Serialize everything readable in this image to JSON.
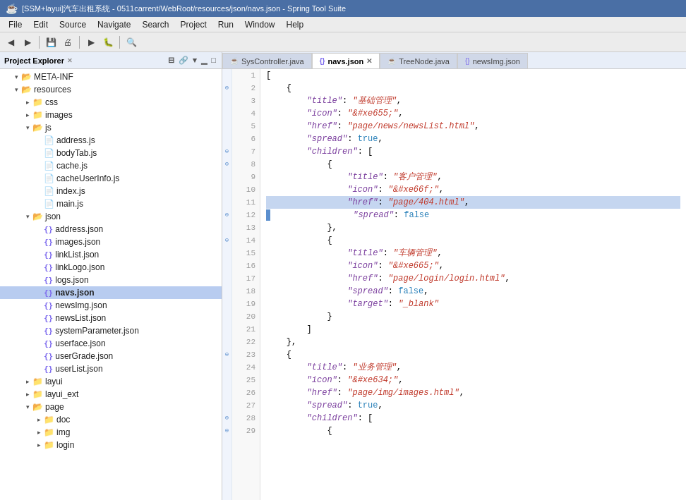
{
  "titleBar": {
    "icon": "☕",
    "title": "[SSM+layui]汽车出租系统 - 0511carrent/WebRoot/resources/json/navs.json - Spring Tool Suite"
  },
  "menuBar": {
    "items": [
      "File",
      "Edit",
      "Source",
      "Navigate",
      "Search",
      "Project",
      "Run",
      "Window",
      "Help"
    ]
  },
  "projectExplorer": {
    "title": "Project Explorer",
    "tree": [
      {
        "indent": 0,
        "expanded": true,
        "icon": "folder",
        "label": "META-INF",
        "type": "folder"
      },
      {
        "indent": 0,
        "expanded": true,
        "icon": "folder",
        "label": "resources",
        "type": "folder"
      },
      {
        "indent": 1,
        "expanded": false,
        "icon": "folder",
        "label": "css",
        "type": "folder"
      },
      {
        "indent": 1,
        "expanded": false,
        "icon": "folder",
        "label": "images",
        "type": "folder"
      },
      {
        "indent": 1,
        "expanded": true,
        "icon": "folder",
        "label": "js",
        "type": "folder"
      },
      {
        "indent": 2,
        "icon": "file-js",
        "label": "address.js",
        "type": "file"
      },
      {
        "indent": 2,
        "icon": "file-js",
        "label": "bodyTab.js",
        "type": "file"
      },
      {
        "indent": 2,
        "icon": "file-js",
        "label": "cache.js",
        "type": "file"
      },
      {
        "indent": 2,
        "icon": "file-js",
        "label": "cacheUserInfo.js",
        "type": "file"
      },
      {
        "indent": 2,
        "icon": "file-js",
        "label": "index.js",
        "type": "file"
      },
      {
        "indent": 2,
        "icon": "file-js",
        "label": "main.js",
        "type": "file"
      },
      {
        "indent": 1,
        "expanded": true,
        "icon": "folder",
        "label": "json",
        "type": "folder"
      },
      {
        "indent": 2,
        "icon": "file-json",
        "label": "address.json",
        "type": "file"
      },
      {
        "indent": 2,
        "icon": "file-json",
        "label": "images.json",
        "type": "file"
      },
      {
        "indent": 2,
        "icon": "file-json",
        "label": "linkList.json",
        "type": "file"
      },
      {
        "indent": 2,
        "icon": "file-json",
        "label": "linkLogo.json",
        "type": "file"
      },
      {
        "indent": 2,
        "icon": "file-json",
        "label": "logs.json",
        "type": "file"
      },
      {
        "indent": 2,
        "icon": "file-json",
        "label": "navs.json",
        "type": "file",
        "selected": true
      },
      {
        "indent": 2,
        "icon": "file-json",
        "label": "newsImg.json",
        "type": "file"
      },
      {
        "indent": 2,
        "icon": "file-json",
        "label": "newsList.json",
        "type": "file"
      },
      {
        "indent": 2,
        "icon": "file-json",
        "label": "systemParameter.json",
        "type": "file"
      },
      {
        "indent": 2,
        "icon": "file-json",
        "label": "userface.json",
        "type": "file"
      },
      {
        "indent": 2,
        "icon": "file-json",
        "label": "userGrade.json",
        "type": "file"
      },
      {
        "indent": 2,
        "icon": "file-json",
        "label": "userList.json",
        "type": "file"
      },
      {
        "indent": 1,
        "expanded": false,
        "icon": "folder",
        "label": "layui",
        "type": "folder"
      },
      {
        "indent": 1,
        "expanded": false,
        "icon": "folder",
        "label": "layui_ext",
        "type": "folder"
      },
      {
        "indent": 1,
        "expanded": true,
        "icon": "folder",
        "label": "page",
        "type": "folder"
      },
      {
        "indent": 2,
        "expanded": false,
        "icon": "folder",
        "label": "doc",
        "type": "folder"
      },
      {
        "indent": 2,
        "expanded": false,
        "icon": "folder",
        "label": "img",
        "type": "folder"
      },
      {
        "indent": 2,
        "expanded": false,
        "icon": "folder",
        "label": "login",
        "type": "folder"
      }
    ]
  },
  "editorTabs": [
    {
      "id": "syscontroller",
      "label": "SysController.java",
      "icon": "java",
      "active": false,
      "closeable": false
    },
    {
      "id": "navsjson",
      "label": "navs.json",
      "icon": "json",
      "active": true,
      "closeable": true
    },
    {
      "id": "treenode",
      "label": "TreeNode.java",
      "icon": "java",
      "active": false,
      "closeable": false
    },
    {
      "id": "newsimgjson",
      "label": "newsImg.json",
      "icon": "json",
      "active": false,
      "closeable": false
    }
  ],
  "codeLines": [
    {
      "num": 1,
      "gutter": "",
      "content": "[",
      "highlight": false
    },
    {
      "num": 2,
      "gutter": "collapse",
      "content": "    {",
      "highlight": false
    },
    {
      "num": 3,
      "gutter": "",
      "content": "        \"title\": \"基础管理\",",
      "highlight": false
    },
    {
      "num": 4,
      "gutter": "",
      "content": "        \"icon\": \"&#xe655;\",",
      "highlight": false
    },
    {
      "num": 5,
      "gutter": "",
      "content": "        \"href\": \"page/news/newsList.html\",",
      "highlight": false
    },
    {
      "num": 6,
      "gutter": "",
      "content": "        \"spread\": true,",
      "highlight": false
    },
    {
      "num": 7,
      "gutter": "collapse",
      "content": "        \"children\": [",
      "highlight": false
    },
    {
      "num": 8,
      "gutter": "collapse",
      "content": "            {",
      "highlight": false
    },
    {
      "num": 9,
      "gutter": "",
      "content": "                \"title\": \"客户管理\",",
      "highlight": false
    },
    {
      "num": 10,
      "gutter": "",
      "content": "                \"icon\": \"&#xe66f;\",",
      "highlight": false
    },
    {
      "num": 11,
      "gutter": "",
      "content": "                \"href\": \"page/404.html\",",
      "highlight": true,
      "cursor": true
    },
    {
      "num": 12,
      "gutter": "collapse",
      "content": "                \"spread\": false",
      "highlight": false,
      "marker": true
    },
    {
      "num": 13,
      "gutter": "",
      "content": "            },",
      "highlight": false
    },
    {
      "num": 14,
      "gutter": "collapse",
      "content": "            {",
      "highlight": false
    },
    {
      "num": 15,
      "gutter": "",
      "content": "                \"title\": \"车辆管理\",",
      "highlight": false
    },
    {
      "num": 16,
      "gutter": "",
      "content": "                \"icon\": \"&#xe665;\",",
      "highlight": false
    },
    {
      "num": 17,
      "gutter": "",
      "content": "                \"href\": \"page/login/login.html\",",
      "highlight": false
    },
    {
      "num": 18,
      "gutter": "",
      "content": "                \"spread\": false,",
      "highlight": false
    },
    {
      "num": 19,
      "gutter": "",
      "content": "                \"target\": \"_blank\"",
      "highlight": false
    },
    {
      "num": 20,
      "gutter": "",
      "content": "            }",
      "highlight": false
    },
    {
      "num": 21,
      "gutter": "",
      "content": "        ]",
      "highlight": false
    },
    {
      "num": 22,
      "gutter": "",
      "content": "    },",
      "highlight": false
    },
    {
      "num": 23,
      "gutter": "collapse",
      "content": "    {",
      "highlight": false
    },
    {
      "num": 24,
      "gutter": "",
      "content": "        \"title\": \"业务管理\",",
      "highlight": false
    },
    {
      "num": 25,
      "gutter": "",
      "content": "        \"icon\": \"&#xe634;\",",
      "highlight": false
    },
    {
      "num": 26,
      "gutter": "",
      "content": "        \"href\": \"page/img/images.html\",",
      "highlight": false
    },
    {
      "num": 27,
      "gutter": "",
      "content": "        \"spread\": true,",
      "highlight": false
    },
    {
      "num": 28,
      "gutter": "collapse",
      "content": "        \"children\": [",
      "highlight": false
    },
    {
      "num": 29,
      "gutter": "collapse",
      "content": "            {",
      "highlight": false
    }
  ],
  "colors": {
    "accent": "#4a6fa5",
    "selectedFile": "#b8ccf0",
    "cursorLine": "#c5d6f0",
    "markerBlue": "#5b8fce"
  }
}
